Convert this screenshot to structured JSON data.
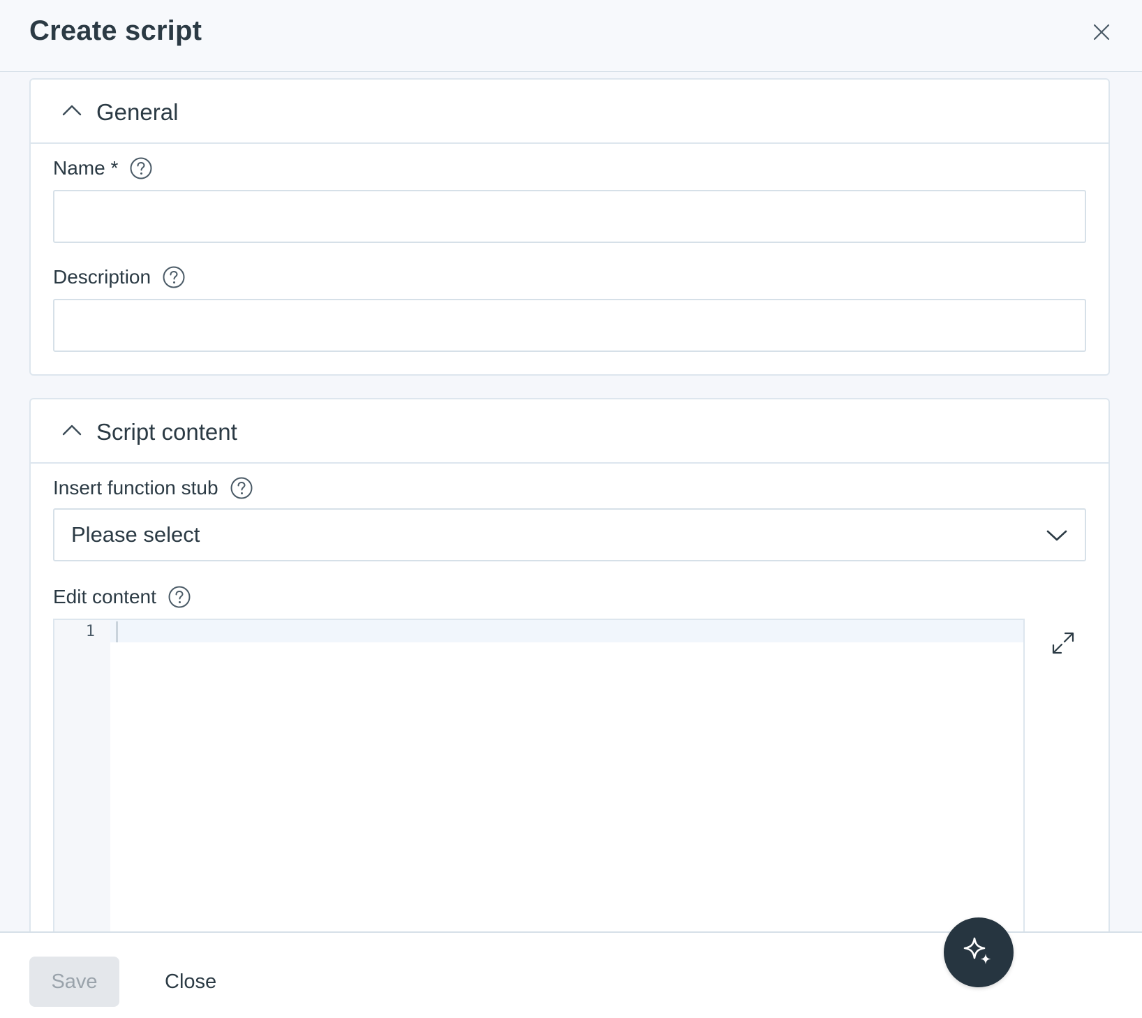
{
  "dialog": {
    "title": "Create script",
    "close_icon": "close-icon"
  },
  "general": {
    "title": "General",
    "name_label": "Name *",
    "name_value": "",
    "description_label": "Description",
    "description_value": ""
  },
  "script_content": {
    "title": "Script content",
    "stub_label": "Insert function stub",
    "stub_selected": "Please select",
    "edit_label": "Edit content",
    "line_numbers": [
      "1"
    ]
  },
  "footer": {
    "save_label": "Save",
    "close_label": "Close"
  },
  "icons": {
    "collapse": "chevron-up-icon",
    "help": "help-circle-icon",
    "dropdown": "chevron-down-icon",
    "expand": "expand-icon",
    "assistant": "sparkle-icon"
  },
  "colors": {
    "text": "#2b3a44",
    "border": "#d6e0e8",
    "fab": "#263540",
    "save_disabled_bg": "#e4e7eb"
  }
}
